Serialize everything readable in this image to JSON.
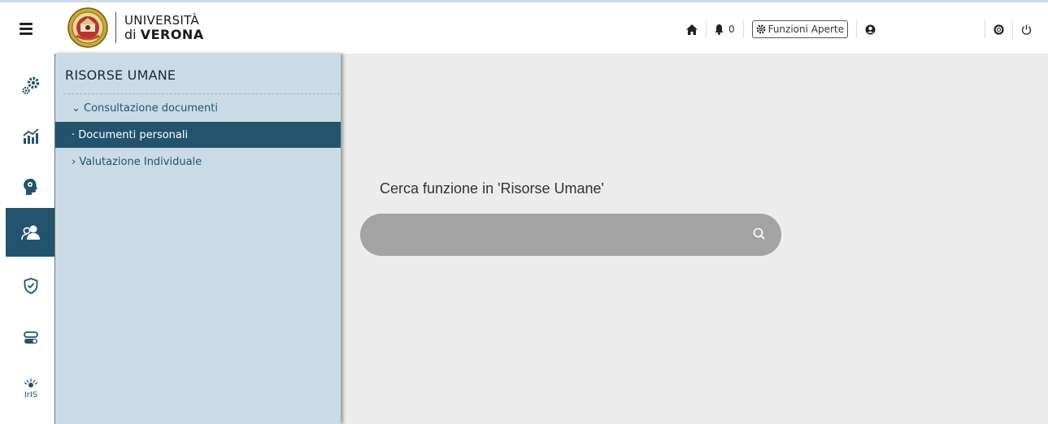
{
  "header": {
    "logo_line1": "UNIVERSITÀ",
    "logo_line2_prefix": "di ",
    "logo_line2_bold": "VERONA",
    "notifications_count": "0",
    "open_functions_label": "Funzioni Aperte"
  },
  "sidebar_rail": {
    "items": [
      {
        "icon": "gears-icon"
      },
      {
        "icon": "chart-icon"
      },
      {
        "icon": "brain-head-icon"
      },
      {
        "icon": "users-icon",
        "active": true
      },
      {
        "icon": "shield-check-icon"
      },
      {
        "icon": "toggles-icon"
      },
      {
        "icon": "iris-icon"
      }
    ]
  },
  "panel": {
    "title": "RISORSE UMANE",
    "items": [
      {
        "label": "⌄ Consultazione documenti"
      },
      {
        "label": "· Documenti personali",
        "active": true
      },
      {
        "label": "› Valutazione Individuale"
      }
    ]
  },
  "main": {
    "search_title": "Cerca funzione in 'Risorse Umane'",
    "search_value": ""
  },
  "colors": {
    "accent": "#23546e",
    "panel_bg": "#c9dce6",
    "search_bg": "#a3a3a3",
    "page_bg": "#ececec"
  }
}
